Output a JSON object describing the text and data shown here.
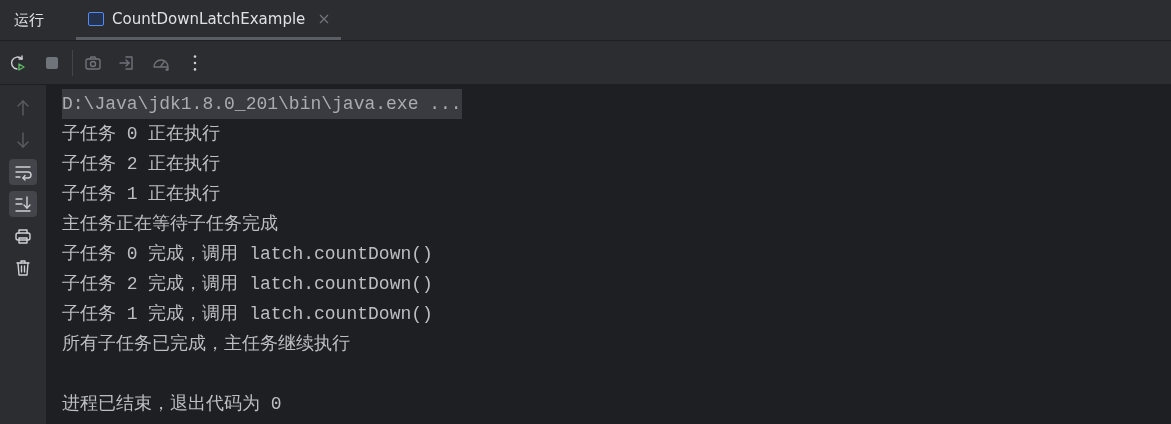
{
  "header": {
    "title": "运行",
    "tabs": [
      {
        "label": "CountDownLatchExample",
        "selected": true
      }
    ]
  },
  "toolbar": [
    {
      "kind": "rerun",
      "disabled": false
    },
    {
      "kind": "stop",
      "disabled": true
    },
    {
      "kind": "camera",
      "disabled": true
    },
    {
      "kind": "login",
      "disabled": true
    },
    {
      "kind": "gauge",
      "disabled": true
    },
    {
      "kind": "more",
      "disabled": false
    }
  ],
  "side_tools": [
    {
      "kind": "up",
      "selected": false,
      "disabled": true
    },
    {
      "kind": "down",
      "selected": false,
      "disabled": true
    },
    {
      "kind": "wrap",
      "selected": true,
      "disabled": false
    },
    {
      "kind": "scroll-end",
      "selected": true,
      "disabled": false
    },
    {
      "kind": "print",
      "selected": false,
      "disabled": false
    },
    {
      "kind": "trash",
      "selected": false,
      "disabled": false
    }
  ],
  "console": [
    {
      "kind": "command",
      "text": "D:\\Java\\jdk1.8.0_201\\bin\\java.exe ..."
    },
    {
      "kind": "output",
      "text": "子任务 0 正在执行"
    },
    {
      "kind": "output",
      "text": "子任务 2 正在执行"
    },
    {
      "kind": "output",
      "text": "子任务 1 正在执行"
    },
    {
      "kind": "output",
      "text": "主任务正在等待子任务完成"
    },
    {
      "kind": "output",
      "text": "子任务 0 完成，调用 latch.countDown()"
    },
    {
      "kind": "output",
      "text": "子任务 2 完成，调用 latch.countDown()"
    },
    {
      "kind": "output",
      "text": "子任务 1 完成，调用 latch.countDown()"
    },
    {
      "kind": "output",
      "text": "所有子任务已完成，主任务继续执行"
    },
    {
      "kind": "exit",
      "text": "进程已结束，退出代码为 0"
    }
  ]
}
